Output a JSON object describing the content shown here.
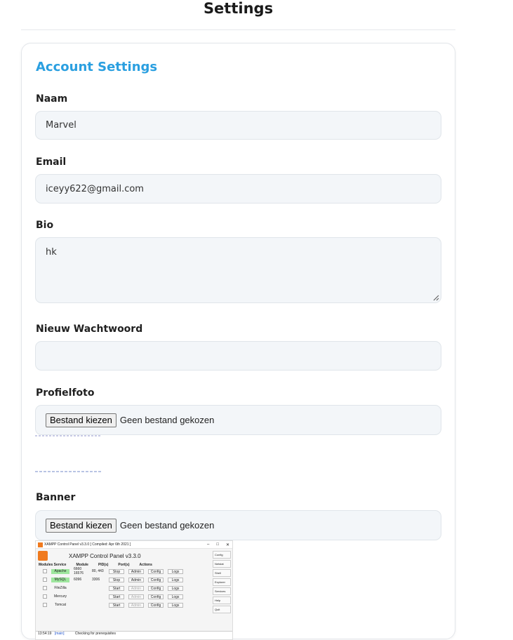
{
  "page": {
    "title": "Settings"
  },
  "card": {
    "title": "Account Settings"
  },
  "form": {
    "name_label": "Naam",
    "name_value": "Marvel",
    "email_label": "Email",
    "email_value": "iceyy622@gmail.com",
    "bio_label": "Bio",
    "bio_value": "hk",
    "password_label": "Nieuw Wachtwoord",
    "password_value": "",
    "profile_label": "Profielfoto",
    "profile_button": "Bestand kiezen",
    "profile_status": "Geen bestand gekozen",
    "banner_label": "Banner",
    "banner_button": "Bestand kiezen",
    "banner_status": "Geen bestand gekozen"
  },
  "banner_preview": {
    "window_title": "XAMPP Control Panel v3.3.0   [ Compiled: Apr 6th 2021 ]",
    "heading": "XAMPP Control Panel v3.3.0",
    "columns": [
      "Modules Service",
      "Module",
      "PID(s)",
      "Port(s)",
      "Actions"
    ],
    "modules": [
      {
        "name": "Apache",
        "pid": "6660 16576",
        "port": "80, 443",
        "action": "Stop",
        "running": true
      },
      {
        "name": "MySQL",
        "pid": "6096",
        "port": "3306",
        "action": "Stop",
        "running": true
      },
      {
        "name": "FileZilla",
        "pid": "",
        "port": "",
        "action": "Start",
        "running": false
      },
      {
        "name": "Mercury",
        "pid": "",
        "port": "",
        "action": "Start",
        "running": false
      },
      {
        "name": "Tomcat",
        "pid": "",
        "port": "",
        "action": "Start",
        "running": false
      }
    ],
    "buttons": [
      "Admin",
      "Config",
      "Logs"
    ],
    "side_buttons": [
      "Config",
      "Netstat",
      "Shell",
      "Explorer",
      "Services",
      "Help",
      "Quit"
    ],
    "log_time": "13:54:19",
    "log_source": "[main]",
    "log_text": "Checking for prerequisites"
  },
  "colors": {
    "accent": "#2a9fe0",
    "field_bg": "#f3f6f9",
    "running_green": "#9ee69e",
    "xampp_orange": "#f07a1e"
  }
}
